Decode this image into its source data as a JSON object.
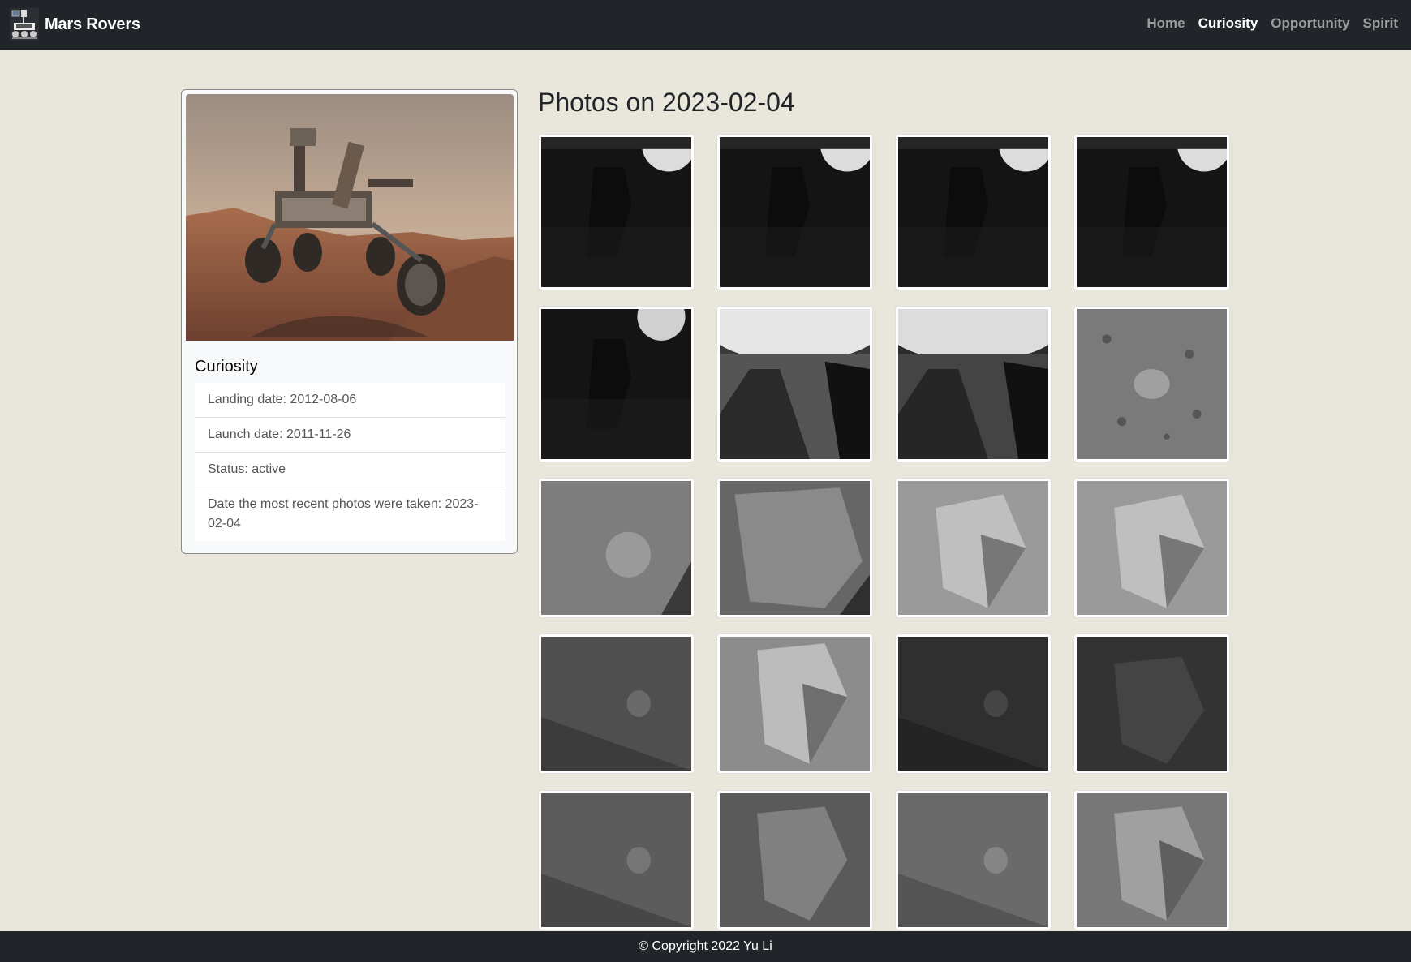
{
  "brand": {
    "name": "Mars Rovers",
    "logo_icon": "rover-logo-icon"
  },
  "nav": {
    "links": [
      {
        "label": "Home",
        "active": false
      },
      {
        "label": "Curiosity",
        "active": true
      },
      {
        "label": "Opportunity",
        "active": false
      },
      {
        "label": "Spirit",
        "active": false
      }
    ]
  },
  "rover": {
    "name": "Curiosity",
    "info": [
      "Landing date: 2012-08-06",
      "Launch date: 2011-11-26",
      "Status: active",
      "Date the most recent photos were taken: 2023-02-04"
    ]
  },
  "photos": {
    "title": "Photos on 2023-02-04",
    "count": 20
  },
  "footer": {
    "text": "© Copyright 2022 Yu Li"
  },
  "colors": {
    "navbar": "#212529",
    "page_background": "#e9e7dc",
    "card_background": "#f8f9fa"
  }
}
